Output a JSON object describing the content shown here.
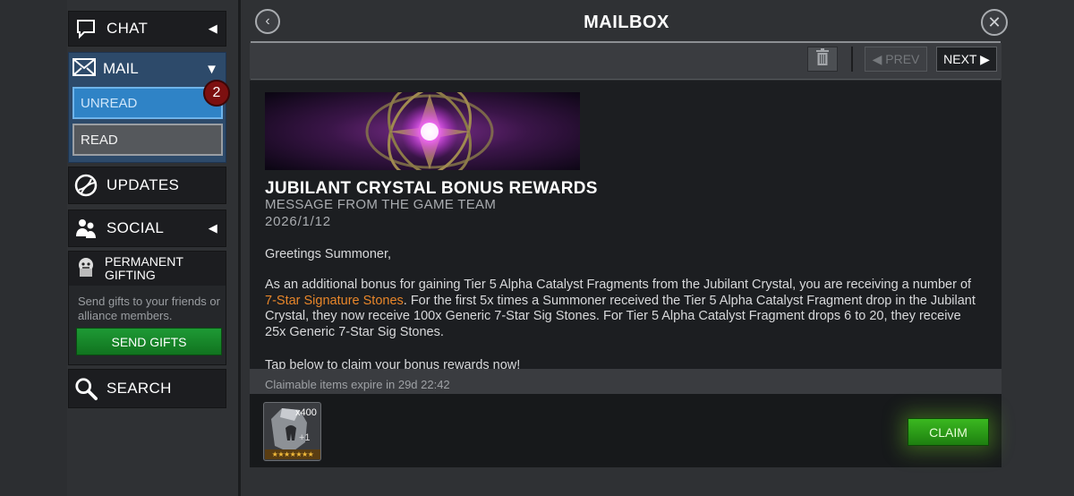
{
  "sidebar": {
    "chat": {
      "label": "CHAT",
      "icon": "chat-bubble-icon",
      "arrow": "◀"
    },
    "mail": {
      "label": "MAIL",
      "icon": "envelope-icon",
      "arrow": "▼",
      "unread": {
        "label": "UNREAD",
        "badge": "2"
      },
      "read": {
        "label": "READ"
      }
    },
    "updates": {
      "label": "UPDATES",
      "icon": "globe-icon"
    },
    "social": {
      "label": "SOCIAL",
      "icon": "people-icon",
      "arrow": "◀"
    },
    "gifting": {
      "title": "PERMANENT GIFTING",
      "icon": "gift-character-icon",
      "description": "Send gifts to your friends or alliance members.",
      "button": "SEND GIFTS"
    },
    "search": {
      "label": "SEARCH",
      "icon": "magnifier-icon"
    }
  },
  "header": {
    "title": "MAILBOX",
    "back_icon": "‹",
    "close_icon": "✕"
  },
  "toolbar": {
    "prev_label": "◀ PREV",
    "next_label": "NEXT ▶"
  },
  "message": {
    "title": "JUBILANT CRYSTAL BONUS REWARDS",
    "from": "MESSAGE FROM THE GAME TEAM",
    "date": "2026/1/12",
    "greeting": "Greetings Summoner,",
    "para1_a": "As an additional bonus for gaining Tier 5 Alpha Catalyst Fragments from the Jubilant Crystal, you are receiving a number of ",
    "para1_link": "7-Star Signature Stones",
    "para1_b": ". For the first 5x times a Summoner received the Tier 5 Alpha Catalyst Fragment drop in the Jubilant Crystal, they now receive 100x Generic 7-Star Sig Stones. For Tier 5 Alpha Catalyst Fragment drops 6 to 20, they receive 25x Generic 7-Star Sig Stones.",
    "para2": "Tap below to claim your bonus rewards now!"
  },
  "rewards": {
    "expire_text": "Claimable items expire in 29d 22:42",
    "item": {
      "quantity": "x400",
      "plus": "+1",
      "stars": "★★★★★★★"
    },
    "claim_label": "CLAIM"
  },
  "colors": {
    "accent_blue": "#2f83c6",
    "highlight_orange": "#e8862a",
    "claim_green": "#3bb820",
    "badge_red": "#7c1010"
  }
}
